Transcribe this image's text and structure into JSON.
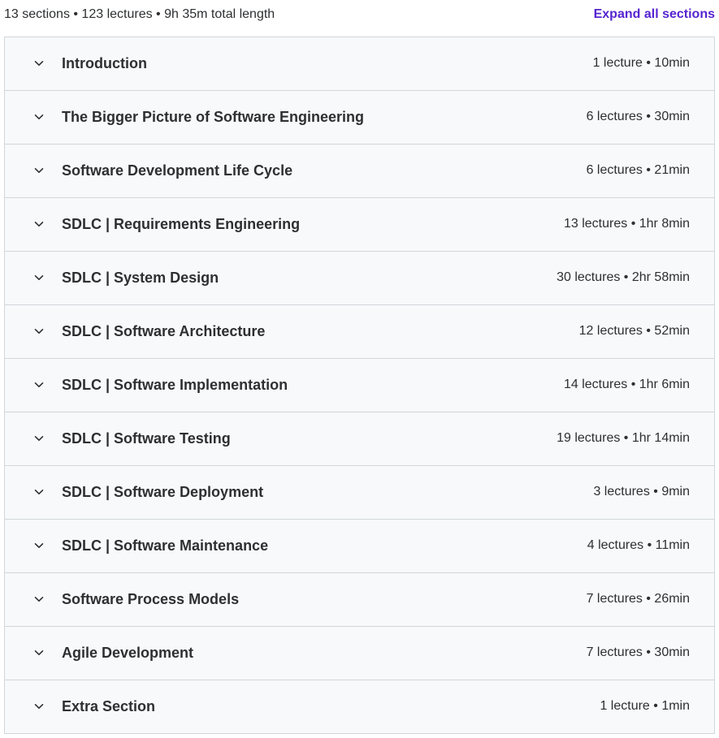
{
  "summary": {
    "text": "13 sections • 123 lectures • 9h 35m total length",
    "expand_label": "Expand all sections"
  },
  "sections": [
    {
      "title": "Introduction",
      "meta": "1 lecture • 10min"
    },
    {
      "title": "The Bigger Picture of Software Engineering",
      "meta": "6 lectures • 30min"
    },
    {
      "title": "Software Development Life Cycle",
      "meta": "6 lectures • 21min"
    },
    {
      "title": "SDLC | Requirements Engineering",
      "meta": "13 lectures • 1hr 8min"
    },
    {
      "title": "SDLC | System Design",
      "meta": "30 lectures • 2hr 58min"
    },
    {
      "title": "SDLC | Software Architecture",
      "meta": "12 lectures • 52min"
    },
    {
      "title": "SDLC | Software Implementation",
      "meta": "14 lectures • 1hr 6min"
    },
    {
      "title": "SDLC | Software Testing",
      "meta": "19 lectures • 1hr 14min"
    },
    {
      "title": "SDLC | Software Deployment",
      "meta": "3 lectures • 9min"
    },
    {
      "title": "SDLC | Software Maintenance",
      "meta": "4 lectures • 11min"
    },
    {
      "title": "Software Process Models",
      "meta": "7 lectures • 26min"
    },
    {
      "title": "Agile Development",
      "meta": "7 lectures • 30min"
    },
    {
      "title": "Extra Section",
      "meta": "1 lecture • 1min"
    }
  ],
  "icons": {
    "section_toggle": "chevron-down-icon"
  },
  "colors": {
    "accent": "#5624d0",
    "text": "#2d2f31",
    "section_bg": "#f7f9fa",
    "border": "#d1d7dc"
  }
}
